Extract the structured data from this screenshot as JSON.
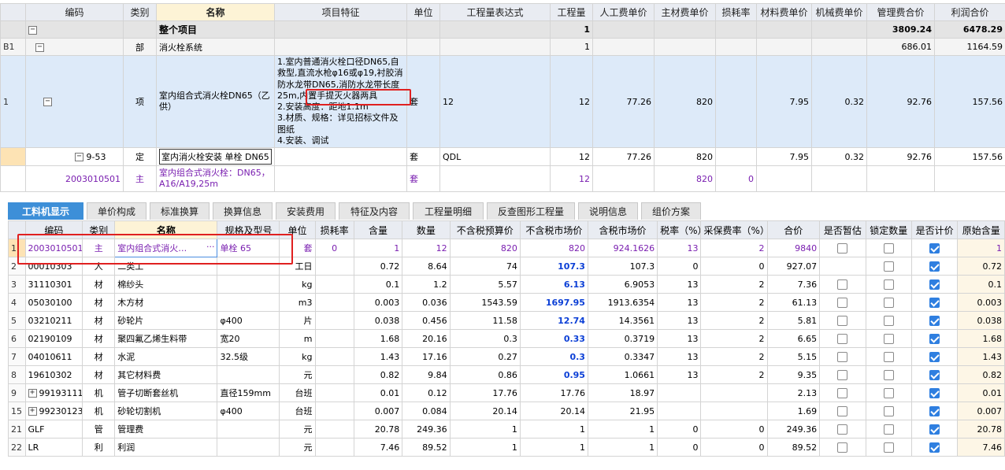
{
  "top_table": {
    "headers": [
      "编码",
      "类别",
      "名称",
      "项目特征",
      "单位",
      "工程量表达式",
      "工程量",
      "人工费单价",
      "主材费单价",
      "损耗率",
      "材料费单价",
      "机械费单价",
      "管理费合价",
      "利润合价"
    ],
    "total_row": {
      "name": "整个项目",
      "qty": "1",
      "mgmt": "3809.24",
      "profit": "6478.29",
      "toggle": "−"
    },
    "b1_row": {
      "rownum": "B1",
      "category": "部",
      "name": "消火栓系统",
      "qty": "1",
      "mgmt": "686.01",
      "profit": "1164.59",
      "toggle": "−"
    },
    "item_row": {
      "rownum": "1",
      "category": "项",
      "name": "室内组合式消火栓DN65（乙供）",
      "features": "1.室内普通消火栓口径DN65,自救型,直流水枪φ16或φ19,衬胶消防水龙带DN65,消防水龙带长度25m,内置手提灭火器两具\n2.安装高度：距地1.1m\n3.材质、规格：详见招标文件及图纸\n4.安装、调试",
      "unit": "套",
      "expr": "12",
      "qty": "12",
      "labor": "77.26",
      "main_mat": "820",
      "mat": "7.95",
      "mach": "0.32",
      "mgmt": "92.76",
      "profit": "157.56",
      "toggle": "−"
    },
    "ding_row": {
      "code": "9-53",
      "category": "定",
      "name": "室内消火栓安装 单栓 DN65",
      "unit": "套",
      "expr": "QDL",
      "qty": "12",
      "labor": "77.26",
      "main_mat": "820",
      "mat": "7.95",
      "mach": "0.32",
      "mgmt": "92.76",
      "profit": "157.56",
      "toggle": "−"
    },
    "main_row": {
      "code": "2003010501",
      "category": "主",
      "name": "室内组合式消火栓：DN65，A16/A19,25m",
      "unit": "套",
      "qty": "12",
      "main_mat": "820",
      "loss": "0"
    }
  },
  "tabs": [
    "工料机显示",
    "单价构成",
    "标准换算",
    "换算信息",
    "安装费用",
    "特征及内容",
    "工程量明细",
    "反查图形工程量",
    "说明信息",
    "组价方案"
  ],
  "bottom_table": {
    "headers": [
      "编码",
      "类别",
      "名称",
      "规格及型号",
      "单位",
      "损耗率",
      "含量",
      "数量",
      "不含税预算价",
      "不含税市场价",
      "含税市场价",
      "税率（%）",
      "采保费率（%）",
      "合价",
      "是否暂估",
      "锁定数量",
      "是否计价",
      "原始含量"
    ],
    "rows": [
      {
        "num": "1",
        "code": "2003010501",
        "cat": "主",
        "name": "室内组合式消火…",
        "spec": "单栓 65",
        "unit": "套",
        "loss": "0",
        "content": "1",
        "amount": "12",
        "budget": "820",
        "market": "820",
        "market_tax": "924.1626",
        "tax": "13",
        "fee": "2",
        "total": "9840",
        "est": false,
        "lock": false,
        "priced": true,
        "orig": "1"
      },
      {
        "num": "2",
        "code": "00010303",
        "cat": "人",
        "name": "二类工",
        "spec": "",
        "unit": "工日",
        "loss": "",
        "content": "0.72",
        "amount": "8.64",
        "budget": "74",
        "market": "107.3",
        "market_tax": "107.3",
        "tax": "0",
        "fee": "0",
        "total": "927.07",
        "est": null,
        "lock": false,
        "priced": true,
        "orig": "0.72"
      },
      {
        "num": "3",
        "code": "31110301",
        "cat": "材",
        "name": "棉纱头",
        "spec": "",
        "unit": "kg",
        "loss": "",
        "content": "0.1",
        "amount": "1.2",
        "budget": "5.57",
        "market": "6.13",
        "market_tax": "6.9053",
        "tax": "13",
        "fee": "2",
        "total": "7.36",
        "est": false,
        "lock": false,
        "priced": true,
        "orig": "0.1"
      },
      {
        "num": "4",
        "code": "05030100",
        "cat": "材",
        "name": "木方材",
        "spec": "",
        "unit": "m3",
        "loss": "",
        "content": "0.003",
        "amount": "0.036",
        "budget": "1543.59",
        "market": "1697.95",
        "market_tax": "1913.6354",
        "tax": "13",
        "fee": "2",
        "total": "61.13",
        "est": false,
        "lock": false,
        "priced": true,
        "orig": "0.003"
      },
      {
        "num": "5",
        "code": "03210211",
        "cat": "材",
        "name": "砂轮片",
        "spec": "φ400",
        "unit": "片",
        "loss": "",
        "content": "0.038",
        "amount": "0.456",
        "budget": "11.58",
        "market": "12.74",
        "market_tax": "14.3561",
        "tax": "13",
        "fee": "2",
        "total": "5.81",
        "est": false,
        "lock": false,
        "priced": true,
        "orig": "0.038"
      },
      {
        "num": "6",
        "code": "02190109",
        "cat": "材",
        "name": "聚四氟乙烯生料带",
        "spec": "宽20",
        "unit": "m",
        "loss": "",
        "content": "1.68",
        "amount": "20.16",
        "budget": "0.3",
        "market": "0.33",
        "market_tax": "0.3719",
        "tax": "13",
        "fee": "2",
        "total": "6.65",
        "est": false,
        "lock": false,
        "priced": true,
        "orig": "1.68"
      },
      {
        "num": "7",
        "code": "04010611",
        "cat": "材",
        "name": "水泥",
        "spec": "32.5级",
        "unit": "kg",
        "loss": "",
        "content": "1.43",
        "amount": "17.16",
        "budget": "0.27",
        "market": "0.3",
        "market_tax": "0.3347",
        "tax": "13",
        "fee": "2",
        "total": "5.15",
        "est": false,
        "lock": false,
        "priced": true,
        "orig": "1.43"
      },
      {
        "num": "8",
        "code": "19610302",
        "cat": "材",
        "name": "其它材料费",
        "spec": "",
        "unit": "元",
        "loss": "",
        "content": "0.82",
        "amount": "9.84",
        "budget": "0.86",
        "market": "0.95",
        "market_tax": "1.0661",
        "tax": "13",
        "fee": "2",
        "total": "9.35",
        "est": false,
        "lock": false,
        "priced": true,
        "orig": "0.82"
      },
      {
        "num": "9",
        "code": "99193111",
        "cat": "机",
        "name": "管子切断套丝机",
        "spec": "直径159mm",
        "unit": "台班",
        "loss": "",
        "content": "0.01",
        "amount": "0.12",
        "budget": "17.76",
        "market": "17.76",
        "market_tax": "18.97",
        "tax": "",
        "fee": "",
        "total": "2.13",
        "est": false,
        "lock": false,
        "priced": true,
        "orig": "0.01",
        "expand": "+"
      },
      {
        "num": "15",
        "code": "99230123",
        "cat": "机",
        "name": "砂轮切割机",
        "spec": "φ400",
        "unit": "台班",
        "loss": "",
        "content": "0.007",
        "amount": "0.084",
        "budget": "20.14",
        "market": "20.14",
        "market_tax": "21.95",
        "tax": "",
        "fee": "",
        "total": "1.69",
        "est": false,
        "lock": false,
        "priced": true,
        "orig": "0.007",
        "expand": "+"
      },
      {
        "num": "21",
        "code": "GLF",
        "cat": "管",
        "name": "管理费",
        "spec": "",
        "unit": "元",
        "loss": "",
        "content": "20.78",
        "amount": "249.36",
        "budget": "1",
        "market": "1",
        "market_tax": "1",
        "tax": "0",
        "fee": "0",
        "total": "249.36",
        "est": false,
        "lock": false,
        "priced": true,
        "orig": "20.78"
      },
      {
        "num": "22",
        "code": "LR",
        "cat": "利",
        "name": "利润",
        "spec": "",
        "unit": "元",
        "loss": "",
        "content": "7.46",
        "amount": "89.52",
        "budget": "1",
        "market": "1",
        "market_tax": "1",
        "tax": "0",
        "fee": "0",
        "total": "89.52",
        "est": false,
        "lock": false,
        "priced": true,
        "orig": "7.46"
      }
    ],
    "blue_market_rows": [
      "2",
      "3",
      "4",
      "5",
      "6",
      "7",
      "8"
    ],
    "ellipsis": "···"
  },
  "colors": {
    "accent": "#3d8fd8",
    "highlight_box": "#e02020",
    "main_material": "#7a1fb0",
    "market_price": "#0b3fd6"
  }
}
